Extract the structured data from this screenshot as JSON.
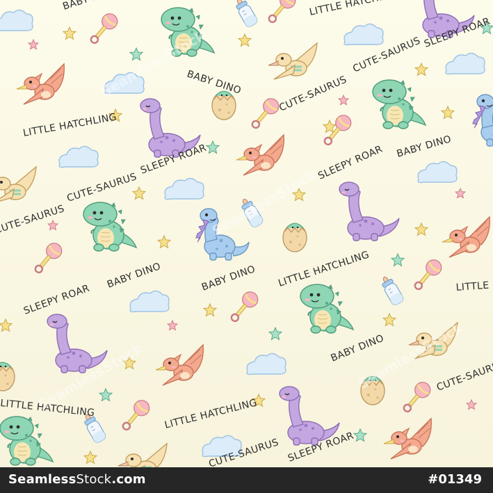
{
  "labels": {
    "baby_dino": "BABY DINO",
    "little_hatchling": "LITTLE HATCHLING",
    "sleepy_roar": "SLEEPY ROAR",
    "cute_saurus": "CUTE-SAURUS"
  },
  "watermark": "SeamlessStock",
  "footer": {
    "brand_bold": "Seamless",
    "brand_light": "Stock",
    "brand_suffix": ".com",
    "code": "#01349"
  },
  "colors": {
    "background_top": "#fdfbea",
    "background_bottom": "#f8f4dc",
    "footer": "#262626",
    "trex_green": "#8fd6b4",
    "brontosaurus_purple": "#c4a6e0",
    "stegosaurus_blue": "#a9cdee",
    "pterodactyl_peach": "#f4a98e",
    "cloud_blue": "#dcecf9",
    "star_yellow": "#f7e08a",
    "star_green": "#9fdcc4",
    "star_pink": "#f6b7c1"
  }
}
